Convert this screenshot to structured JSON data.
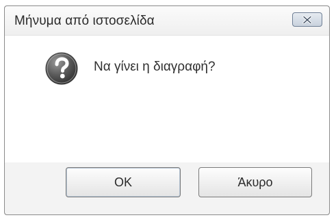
{
  "dialog": {
    "title": "Μήνυμα από ιστοσελίδα",
    "message": "Να γίνει η διαγραφή?",
    "icon": "question-icon",
    "close_icon": "close-icon",
    "buttons": {
      "ok_label": "OK",
      "cancel_label": "Άκυρο"
    }
  }
}
